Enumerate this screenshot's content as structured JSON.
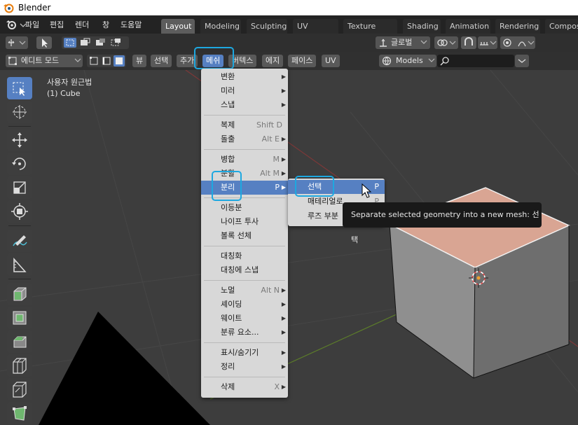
{
  "window": {
    "title": "Blender"
  },
  "topmenu": {
    "items": [
      "파일",
      "편집",
      "렌더",
      "창",
      "도움말"
    ]
  },
  "workspaces": {
    "tabs": [
      "Layout",
      "Modeling",
      "Sculpting",
      "UV Editing",
      "Texture Paint",
      "Shading",
      "Animation",
      "Rendering",
      "Composit"
    ],
    "active": "Layout"
  },
  "header": {
    "transform_orientation": "글로벌",
    "mode": "에디트 모드",
    "menus": [
      "뷰",
      "선택",
      "추가",
      "메쉬",
      "버텍스",
      "에지",
      "페이스",
      "UV"
    ],
    "active_menu": "메쉬",
    "collection": "Models",
    "search_value": ""
  },
  "overlay": {
    "view_name": "사용자 원근법",
    "object_name": "(1) Cube"
  },
  "mesh_menu": {
    "items": [
      {
        "label": "변환",
        "shortcut": "",
        "submenu": true
      },
      {
        "label": "미러",
        "shortcut": "",
        "submenu": true
      },
      {
        "label": "스냅",
        "shortcut": "",
        "submenu": true
      },
      {
        "label": "복제",
        "shortcut": "Shift D",
        "submenu": false
      },
      {
        "label": "돌출",
        "shortcut": "Alt E",
        "submenu": true
      },
      {
        "label": "병합",
        "shortcut": "M",
        "submenu": true
      },
      {
        "label": "분할",
        "shortcut": "Alt M",
        "submenu": true
      },
      {
        "label": "분리",
        "shortcut": "P",
        "submenu": true
      },
      {
        "label": "이등분",
        "shortcut": "",
        "submenu": false
      },
      {
        "label": "나이프 투사",
        "shortcut": "",
        "submenu": false
      },
      {
        "label": "볼록 선체",
        "shortcut": "",
        "submenu": false
      },
      {
        "label": "대칭화",
        "shortcut": "",
        "submenu": false
      },
      {
        "label": "대칭에 스냅",
        "shortcut": "",
        "submenu": false
      },
      {
        "label": "노멀",
        "shortcut": "Alt N",
        "submenu": true
      },
      {
        "label": "셰이딩",
        "shortcut": "",
        "submenu": true
      },
      {
        "label": "웨이트",
        "shortcut": "",
        "submenu": true
      },
      {
        "label": "분류 요소...",
        "shortcut": "",
        "submenu": true
      },
      {
        "label": "표시/숨기기",
        "shortcut": "",
        "submenu": true
      },
      {
        "label": "정리",
        "shortcut": "",
        "submenu": true
      },
      {
        "label": "삭제",
        "shortcut": "X",
        "submenu": true
      }
    ],
    "highlighted": "분리"
  },
  "separate_submenu": {
    "items": [
      {
        "label": "선택",
        "shortcut": "P"
      },
      {
        "label": "매테리얼로",
        "shortcut": "P"
      },
      {
        "label": "루즈 부분",
        "shortcut": ""
      }
    ],
    "highlighted": "선택"
  },
  "tooltip": {
    "text": "Separate selected geometry into a new mesh:  선택"
  },
  "colors": {
    "accent": "#5680c2",
    "highlight_ring": "#1ea8e0",
    "menu_bg": "#d8d8d8",
    "viewport": "#3d3d3d"
  }
}
